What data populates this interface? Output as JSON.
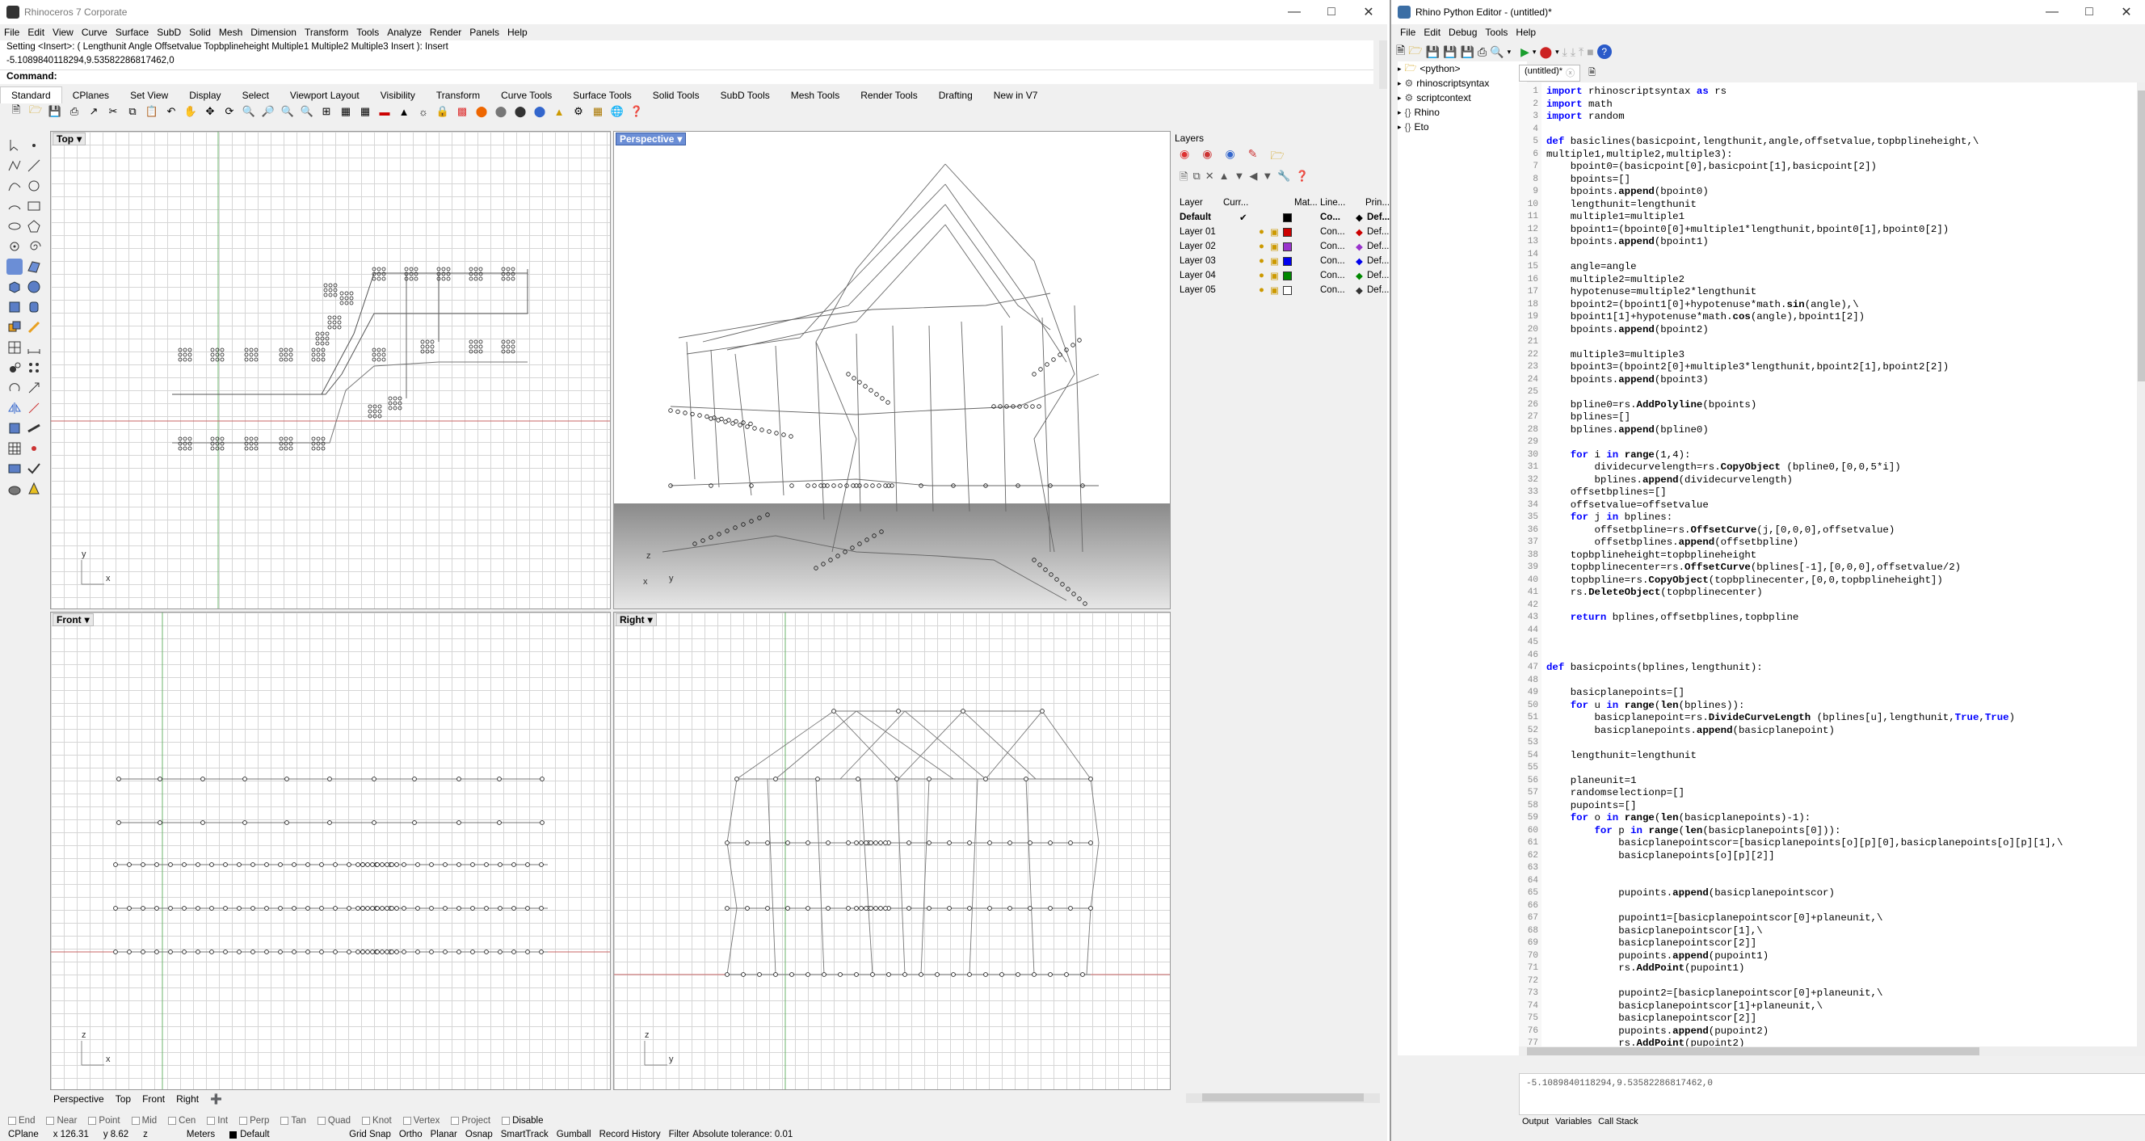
{
  "rhino": {
    "title": "Rhinoceros 7 Corporate",
    "menu": [
      "File",
      "Edit",
      "View",
      "Curve",
      "Surface",
      "SubD",
      "Solid",
      "Mesh",
      "Dimension",
      "Transform",
      "Tools",
      "Analyze",
      "Render",
      "Panels",
      "Help"
    ],
    "history": [
      "Setting <Insert>: ( Lengthunit  Angle  Offsetvalue  Topbplineheight  Multiple1  Multiple2  Multiple3  Insert ): Insert",
      "-5.1089840118294,9.53582286817462,0"
    ],
    "command_label": "Command:",
    "tabs": [
      "Standard",
      "CPlanes",
      "Set View",
      "Display",
      "Select",
      "Viewport Layout",
      "Visibility",
      "Transform",
      "Curve Tools",
      "Surface Tools",
      "Solid Tools",
      "SubD Tools",
      "Mesh Tools",
      "Render Tools",
      "Drafting",
      "New in V7"
    ],
    "viewports": {
      "top": "Top",
      "perspective": "Perspective",
      "front": "Front",
      "right": "Right"
    },
    "viewport_tabs": [
      "Perspective",
      "Top",
      "Front",
      "Right"
    ],
    "osnap": [
      "End",
      "Near",
      "Point",
      "Mid",
      "Cen",
      "Int",
      "Perp",
      "Tan",
      "Quad",
      "Knot",
      "Vertex",
      "Project",
      "Disable"
    ],
    "status": {
      "cplane": "CPlane",
      "x": "x 126.31",
      "y": "y 8.62",
      "z": "z",
      "units": "Meters",
      "layer": "Default",
      "toggles": [
        "Grid Snap",
        "Ortho",
        "Planar",
        "Osnap",
        "SmartTrack",
        "Gumball",
        "Record History",
        "Filter"
      ],
      "tolerance": "Absolute tolerance: 0.01"
    },
    "layers": {
      "title": "Layers",
      "columns": [
        "Layer",
        "Curr...",
        "Mat...",
        "Line...",
        "Prin..."
      ],
      "rows": [
        {
          "name": "Default",
          "color": "#000000",
          "line": "Co...",
          "print": "Def..."
        },
        {
          "name": "Layer 01",
          "color": "#cc0000",
          "line": "Con...",
          "print": "Def..."
        },
        {
          "name": "Layer 02",
          "color": "#9933cc",
          "line": "Con...",
          "print": "Def..."
        },
        {
          "name": "Layer 03",
          "color": "#0000ee",
          "line": "Con...",
          "print": "Def..."
        },
        {
          "name": "Layer 04",
          "color": "#008800",
          "line": "Con...",
          "print": "Def..."
        },
        {
          "name": "Layer 05",
          "color": "#ffffff",
          "line": "Con...",
          "print": "Def..."
        }
      ]
    }
  },
  "python": {
    "title": "Rhino Python Editor - (untitled)*",
    "menu": [
      "File",
      "Edit",
      "Debug",
      "Tools",
      "Help"
    ],
    "tree": [
      "<python>",
      "rhinoscriptsyntax",
      "scriptcontext",
      "Rhino",
      "Eto"
    ],
    "doc_tab": "(untitled)*",
    "code": [
      "import rhinoscriptsyntax as rs",
      "import math",
      "import random",
      "",
      "def basiclines(basicpoint,lengthunit,angle,offsetvalue,topbplineheight,\\",
      "multiple1,multiple2,multiple3):",
      "    bpoint0=(basicpoint[0],basicpoint[1],basicpoint[2])",
      "    bpoints=[]",
      "    bpoints.append(bpoint0)",
      "    lengthunit=lengthunit",
      "    multiple1=multiple1",
      "    bpoint1=(bpoint0[0]+multiple1*lengthunit,bpoint0[1],bpoint0[2])",
      "    bpoints.append(bpoint1)",
      "",
      "    angle=angle",
      "    multiple2=multiple2",
      "    hypotenuse=multiple2*lengthunit",
      "    bpoint2=(bpoint1[0]+hypotenuse*math.sin(angle),\\",
      "    bpoint1[1]+hypotenuse*math.cos(angle),bpoint1[2])",
      "    bpoints.append(bpoint2)",
      "",
      "    multiple3=multiple3",
      "    bpoint3=(bpoint2[0]+multiple3*lengthunit,bpoint2[1],bpoint2[2])",
      "    bpoints.append(bpoint3)",
      "",
      "    bpline0=rs.AddPolyline(bpoints)",
      "    bplines=[]",
      "    bplines.append(bpline0)",
      "",
      "    for i in range(1,4):",
      "        dividecurvelength=rs.CopyObject (bpline0,[0,0,5*i])",
      "        bplines.append(dividecurvelength)",
      "    offsetbplines=[]",
      "    offsetvalue=offsetvalue",
      "    for j in bplines:",
      "        offsetbpline=rs.OffsetCurve(j,[0,0,0],offsetvalue)",
      "        offsetbplines.append(offsetbpline)",
      "    topbplineheight=topbplineheight",
      "    topbplinecenter=rs.OffsetCurve(bplines[-1],[0,0,0],offsetvalue/2)",
      "    topbpline=rs.CopyObject(topbplinecenter,[0,0,topbplineheight])",
      "    rs.DeleteObject(topbplinecenter)",
      "",
      "    return bplines,offsetbplines,topbpline",
      "",
      "",
      "",
      "def basicpoints(bplines,lengthunit):",
      "",
      "    basicplanepoints=[]",
      "    for u in range(len(bplines)):",
      "        basicplanepoint=rs.DivideCurveLength (bplines[u],lengthunit,True,True)",
      "        basicplanepoints.append(basicplanepoint)",
      "",
      "    lengthunit=lengthunit",
      "",
      "    planeunit=1",
      "    randomselectionp=[]",
      "    pupoints=[]",
      "    for o in range(len(basicplanepoints)-1):",
      "        for p in range(len(basicplanepoints[0])):",
      "            basicplanepointscor=[basicplanepoints[o][p][0],basicplanepoints[o][p][1],\\",
      "            basicplanepoints[o][p][2]]",
      "",
      "",
      "            pupoints.append(basicplanepointscor)",
      "",
      "            pupoint1=[basicplanepointscor[0]+planeunit,\\",
      "            basicplanepointscor[1],\\",
      "            basicplanepointscor[2]]",
      "            pupoints.append(pupoint1)",
      "            rs.AddPoint(pupoint1)",
      "",
      "            pupoint2=[basicplanepointscor[0]+planeunit,\\",
      "            basicplanepointscor[1]+planeunit,\\",
      "            basicplanepointscor[2]]",
      "            pupoints.append(pupoint2)",
      "            rs.AddPoint(pupoint2)"
    ],
    "output_text": "-5.1089840118294,9.53582286817462,0",
    "output_tabs": [
      "Output",
      "Variables",
      "Call Stack"
    ]
  }
}
